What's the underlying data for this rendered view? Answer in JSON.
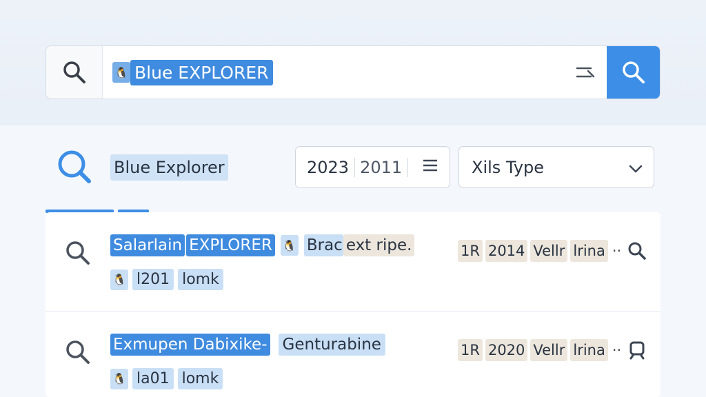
{
  "search": {
    "query": "Blue EXPLORER",
    "badge_glyph": "🐧"
  },
  "filters": {
    "label": "Blue Explorer",
    "year_a": "2023",
    "year_b": "2011",
    "type_label": "Xils Type"
  },
  "results": [
    {
      "title_1": "Salarlain",
      "title_2": "EXPLORER",
      "title_3": "Brac",
      "title_4": "ext ripe.",
      "sub_text_1": "l201",
      "sub_text_2": "lomk",
      "meta_1": "1R",
      "meta_2": "2014",
      "meta_3": "Vellr",
      "meta_4": "lrina",
      "dots": "··"
    },
    {
      "title_1": "Exmupen Dabixike-",
      "title_2": "Genturabine",
      "sub_text_1": "la01",
      "sub_text_2": "lomk",
      "meta_1": "1R",
      "meta_2": "2020",
      "meta_3": "Vellr",
      "meta_4": "lrina",
      "dots": "··"
    }
  ],
  "colors": {
    "accent": "#3d8ee6",
    "highlight_light": "#c9dff5",
    "chip_beige": "#ece6dc"
  }
}
